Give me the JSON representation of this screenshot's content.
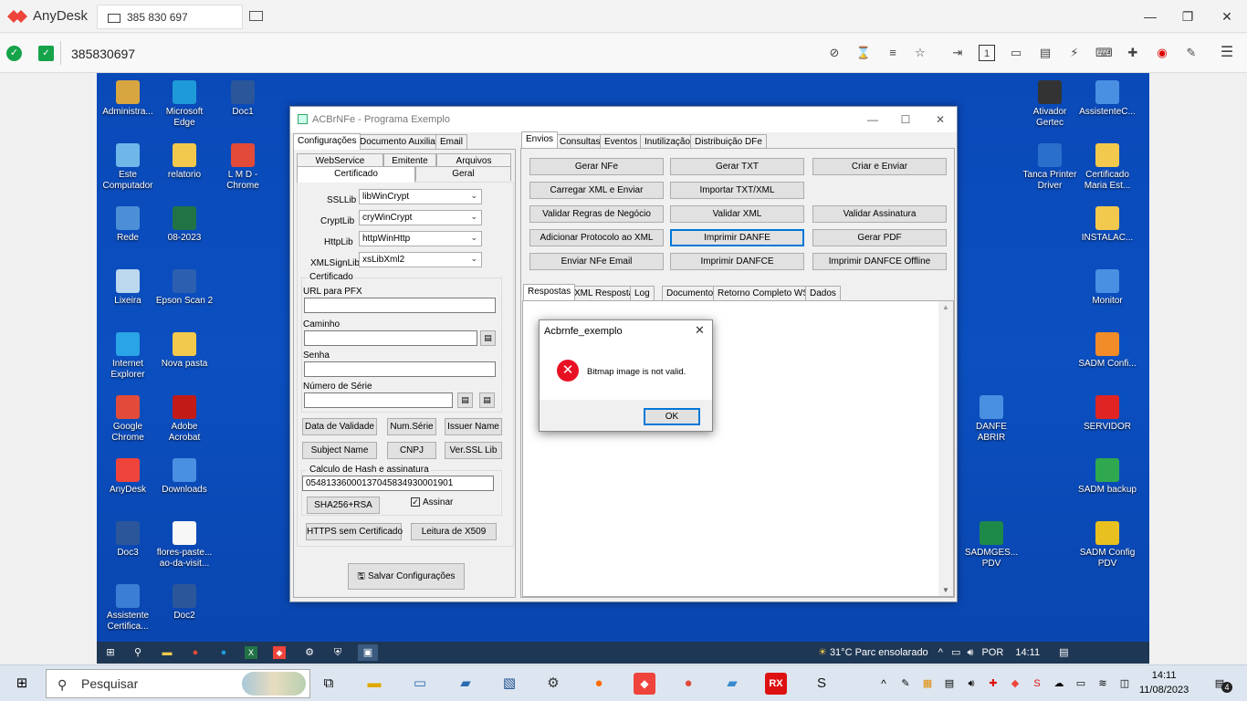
{
  "anydesk": {
    "app_name": "AnyDesk",
    "tab_label": "385 830 697",
    "connection_id": "385830697",
    "window_controls": {
      "min": "—",
      "max": "❐",
      "close": "✕"
    },
    "toolbar_icons": [
      "privacy-icon",
      "hourglass-icon",
      "database-icon",
      "star-icon",
      "file-transfer-icon",
      "monitor-1-icon",
      "display-icon",
      "chat-icon",
      "actions-icon",
      "keyboard-icon",
      "plugins-icon",
      "record-icon",
      "draw-icon",
      "menu-icon"
    ]
  },
  "desktop": {
    "left_icons": [
      {
        "label": "Administra...",
        "color": "#d8a640"
      },
      {
        "label": "Microsoft Edge",
        "color": "#1f9ad8"
      },
      {
        "label": "Doc1",
        "color": "#2b579a"
      },
      {
        "label": "Este Computador",
        "color": "#6fb7e8"
      },
      {
        "label": "relatorio",
        "color": "#f2c94c"
      },
      {
        "label": "L M D - Chrome",
        "color": "#e24b3a"
      },
      {
        "label": "Rede",
        "color": "#4c8fd6"
      },
      {
        "label": "08-2023",
        "color": "#217346"
      },
      {
        "label": "Lixeira",
        "color": "#bcd8ef"
      },
      {
        "label": "Epson Scan 2",
        "color": "#2d5fb0"
      },
      {
        "label": "Internet Explorer",
        "color": "#2aa4e6"
      },
      {
        "label": "Nova pasta",
        "color": "#f2c94c"
      },
      {
        "label": "Google Chrome",
        "color": "#e24b3a"
      },
      {
        "label": "Adobe Acrobat",
        "color": "#c21b17"
      },
      {
        "label": "AnyDesk",
        "color": "#ef443b"
      },
      {
        "label": "Downloads",
        "color": "#4a90e2"
      },
      {
        "label": "Doc3",
        "color": "#2b579a"
      },
      {
        "label": "flores-paste... ao-da-visit...",
        "color": "#f7f7f7"
      },
      {
        "label": "Assistente Certifica...",
        "color": "#3b7ed6"
      },
      {
        "label": "Doc2",
        "color": "#2b579a"
      }
    ],
    "right_icons": [
      {
        "label": "Ativador Gertec",
        "color": "#333333"
      },
      {
        "label": "AssistenteC...",
        "color": "#4a90e2"
      },
      {
        "label": "Tanca Printer Driver",
        "color": "#2a6fc9"
      },
      {
        "label": "Certificado Maria Est...",
        "color": "#f2c94c"
      },
      {
        "label": "INSTALAC...",
        "color": "#f2c94c"
      },
      {
        "label": "Monitor",
        "color": "#4a90e2"
      },
      {
        "label": "SADM Confi...",
        "color": "#f28c28"
      },
      {
        "label": "DANFE ABRIR",
        "color": "#4a90e2"
      },
      {
        "label": "SERVIDOR",
        "color": "#e02424"
      },
      {
        "label": "SADM backup",
        "color": "#2fa84f"
      },
      {
        "label": "SADMGES... PDV",
        "color": "#1d8a4a"
      },
      {
        "label": "SADM Config PDV",
        "color": "#e8c020"
      }
    ]
  },
  "acbr": {
    "title": "ACBrNFe - Programa Exemplo",
    "left_tabs": [
      "Configurações",
      "Documento Auxiliar",
      "Email"
    ],
    "sub_tabs_row1": [
      "WebService",
      "Emitente",
      "Arquivos"
    ],
    "sub_tabs_row2": [
      "Certificado",
      "Geral"
    ],
    "ssllib_label": "SSLLib",
    "ssllib_value": "libWinCrypt",
    "cryptlib_label": "CryptLib",
    "cryptlib_value": "cryWinCrypt",
    "httplib_label": "HttpLib",
    "httplib_value": "httpWinHttp",
    "xmlsign_label": "XMLSignLib",
    "xmlsign_value": "xsLibXml2",
    "cert_group": "Certificado",
    "url_label": "URL para PFX",
    "caminho_label": "Caminho",
    "senha_label": "Senha",
    "serie_label": "Número de Série",
    "btn_validade": "Data de Validade",
    "btn_numserie": "Num.Série",
    "btn_issuer": "Issuer Name",
    "btn_subject": "Subject Name",
    "btn_cnpj": "CNPJ",
    "btn_ssl": "Ver.SSL Lib",
    "hash_group": "Calculo de Hash e assinatura",
    "hash_value": "05481336000137045834930001901",
    "btn_sha": "SHA256+RSA",
    "assinar_label": "Assinar",
    "btn_https": "HTTPS sem Certificado",
    "btn_x509": "Leitura de X509",
    "btn_salvar": "Salvar Configurações",
    "right_tabs": [
      "Envios",
      "Consultas",
      "Eventos",
      "Inutilização",
      "Distribuição DFe"
    ],
    "envio_buttons": [
      "Gerar NFe",
      "Gerar TXT",
      "Criar e Enviar",
      "Carregar XML e Enviar",
      "Importar TXT/XML",
      "",
      "Validar Regras de Negócio",
      "Validar XML",
      "Validar Assinatura",
      "Adicionar Protocolo ao XML",
      "Imprimir DANFE",
      "Gerar PDF",
      "Enviar NFe Email",
      "Imprimir DANFCE",
      "Imprimir DANFCE Offline"
    ],
    "resp_tabs": [
      "Respostas",
      "XML Resposta",
      "Log",
      "Documento",
      "Retorno Completo WS",
      "Dados"
    ]
  },
  "dialog": {
    "title": "Acbrnfe_exemplo",
    "message": "Bitmap image is not valid.",
    "ok": "OK"
  },
  "remote_taskbar": {
    "weather": "31°C  Parc ensolarado",
    "lang": "POR",
    "time": "14:11"
  },
  "local_taskbar": {
    "search_placeholder": "Pesquisar",
    "time": "14:11",
    "date": "11/08/2023",
    "notif_count": "4"
  }
}
